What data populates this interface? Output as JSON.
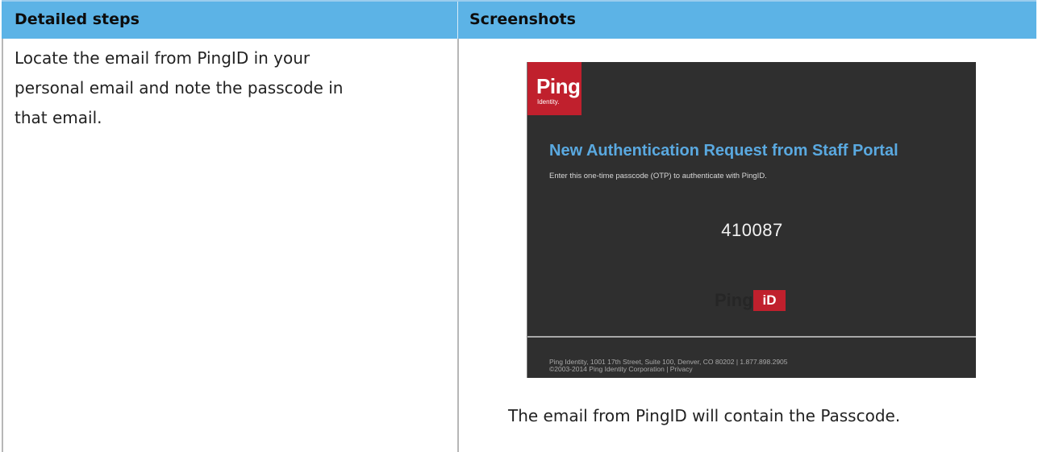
{
  "table": {
    "header": {
      "col1": "Detailed steps",
      "col2": "Screenshots"
    },
    "row1": {
      "step_lines": [
        "Locate the email from PingID in your",
        "personal email and note the passcode in",
        "that email."
      ],
      "caption": "The email from PingID will contain the Passcode."
    }
  },
  "email_screenshot": {
    "logo_word": "Ping",
    "logo_sub": "Identity.",
    "title": "New Authentication Request from Staff Portal",
    "instruction": "Enter this one-time passcode (OTP) to authenticate with PingID.",
    "passcode": "410087",
    "brand_ping": "Ping",
    "brand_id": "iD",
    "footer_line1": "Ping Identity, 1001 17th Street, Suite 100, Denver, CO 80202 | 1.877.898.2905",
    "footer_line2": "©2003-2014 Ping Identity Corporation | Privacy"
  },
  "colors": {
    "header_bg": "#5cb3e6",
    "email_bg": "#2f2f2f",
    "ping_red": "#c0202d",
    "title_blue": "#5aa9e0"
  }
}
